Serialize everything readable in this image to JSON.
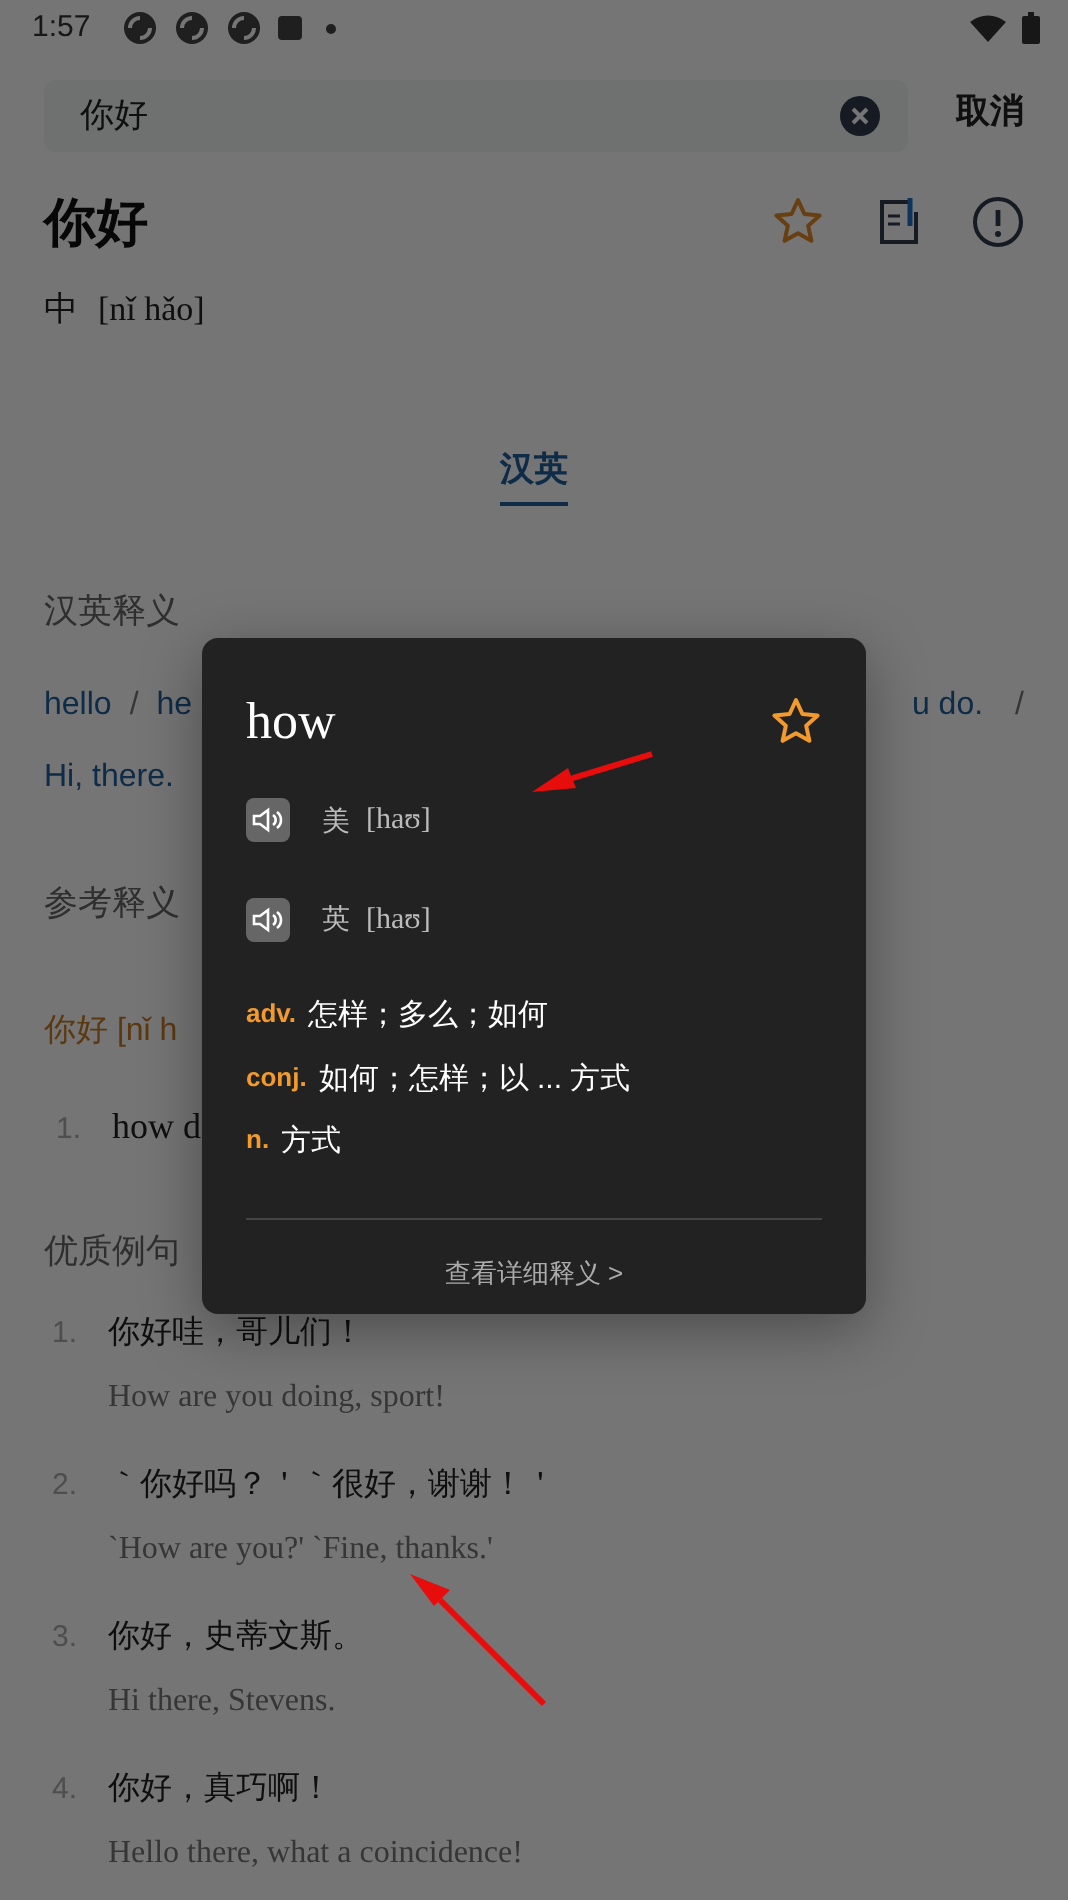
{
  "status_bar": {
    "time": "1:57"
  },
  "search": {
    "value": "你好",
    "cancel": "取消"
  },
  "entry": {
    "word": "你好",
    "lang": "中",
    "pinyin": "[nǐ hǎo]"
  },
  "tabs": [
    {
      "label": "汉英",
      "selected": true
    }
  ],
  "cn_en": {
    "heading": "汉英释义",
    "line_1_left": [
      "hello",
      "/",
      "he"
    ],
    "line_1_right": [
      "u do.",
      "/"
    ],
    "line_2": [
      "Hi, there."
    ]
  },
  "reference": {
    "heading": "参考释义",
    "headword": "你好 [nǐ h",
    "items": [
      {
        "num": "1.",
        "text": "how d"
      }
    ]
  },
  "examples": {
    "heading": "优质例句",
    "items": [
      {
        "num": "1.",
        "zh": "你好哇，哥儿们！",
        "en": "How are you doing, sport!"
      },
      {
        "num": "2.",
        "zh": "｀你好吗？＇｀很好，谢谢！＇",
        "en": "`How are you?' `Fine, thanks.'"
      },
      {
        "num": "3.",
        "zh": "你好，史蒂文斯。",
        "en": "Hi there, Stevens."
      },
      {
        "num": "4.",
        "zh": "你好，真巧啊！",
        "en": "Hello there, what a coincidence!"
      }
    ]
  },
  "popup": {
    "word": "how",
    "pronunciations": [
      {
        "region": "美",
        "ipa": "[haʊ]"
      },
      {
        "region": "英",
        "ipa": "[haʊ]"
      }
    ],
    "senses": [
      {
        "pos": "adv.",
        "meaning": "怎样；多么；如何"
      },
      {
        "pos": "conj.",
        "meaning": "如何；怎样；以 ... 方式"
      },
      {
        "pos": "n.",
        "meaning": "方式"
      }
    ],
    "more": "查看详细释义 >"
  }
}
